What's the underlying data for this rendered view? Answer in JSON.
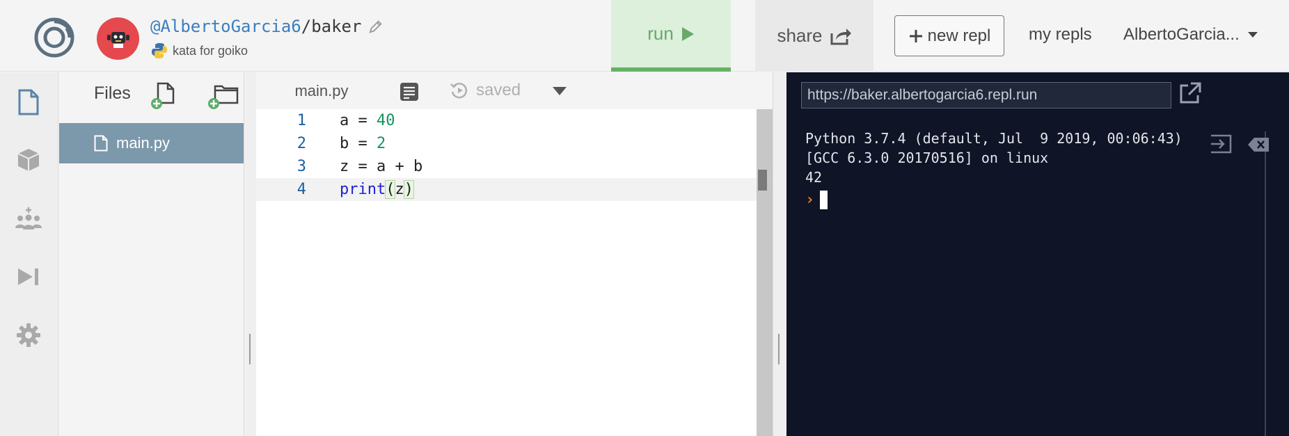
{
  "header": {
    "username": "@AlbertoGarcia6",
    "separator": "/",
    "repl_name": "baker",
    "language_description": "kata for goiko",
    "run_label": "run",
    "share_label": "share",
    "new_repl_label": "new repl",
    "my_repls_label": "my repls",
    "user_menu_label": "AlbertoGarcia..."
  },
  "files_panel": {
    "title": "Files",
    "files": [
      {
        "name": "main.py"
      }
    ]
  },
  "editor": {
    "active_tab": "main.py",
    "status": "saved",
    "lines": [
      {
        "number": "1",
        "code": "a = 40"
      },
      {
        "number": "2",
        "code": "b = 2"
      },
      {
        "number": "3",
        "code": "z = a + b"
      },
      {
        "number": "4",
        "code": "print(z)"
      }
    ]
  },
  "console": {
    "url": "https://baker.albertogarcia6.repl.run",
    "output_lines": [
      "Python 3.7.4 (default, Jul  9 2019, 00:06:43)",
      "[GCC 6.3.0 20170516] on linux",
      "42"
    ],
    "prompt_glyph": "›"
  },
  "icons": {
    "logo": "repl-logo-icon",
    "avatar": "robot-avatar-icon",
    "pencil": "pencil-icon",
    "python": "python-icon",
    "run": "play-icon",
    "share": "share-icon",
    "new": "plus-icon",
    "user": "caret-down-icon",
    "rail": [
      "file-icon",
      "package-icon",
      "multiplayer-icon",
      "debugger-icon",
      "settings-icon"
    ]
  },
  "colors": {
    "run_bg": "#dcf0dc",
    "run_accent": "#66b066",
    "file_selected": "#7c98ab",
    "console_bg": "#0f1426",
    "avatar_bg": "#e5484d",
    "username": "#3c7ebf"
  }
}
